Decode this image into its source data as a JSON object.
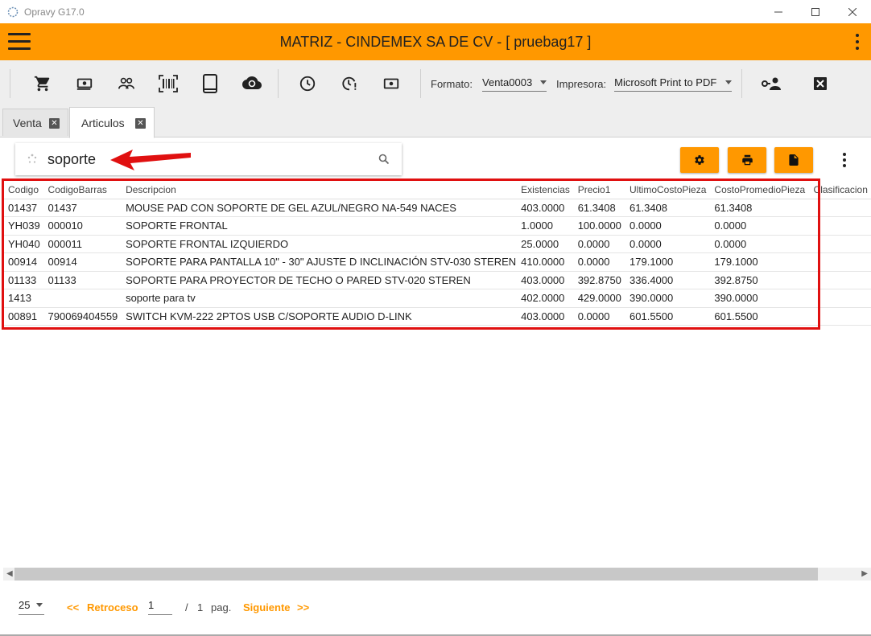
{
  "window": {
    "title": "Opravy G17.0"
  },
  "header": {
    "title": "MATRIZ - CINDEMEX SA DE CV - [ pruebag17 ]"
  },
  "toolbar": {
    "icons": [
      "cart-icon",
      "cash-icon",
      "users-icon",
      "barcode-icon",
      "tablet-icon",
      "cloud-sync-icon",
      "clock-icon",
      "clock-alert-icon",
      "money-icon"
    ],
    "formato_label": "Formato:",
    "formato_value": "Venta0003",
    "impresora_label": "Impresora:",
    "impresora_value": "Microsoft Print to PDF"
  },
  "tabs": [
    {
      "label": "Venta",
      "active": false
    },
    {
      "label": "Articulos",
      "active": true
    }
  ],
  "search": {
    "value": "soporte"
  },
  "table": {
    "columns": [
      "Codigo",
      "CodigoBarras",
      "Descripcion",
      "Existencias",
      "Precio1",
      "UltimoCostoPieza",
      "CostoPromedioPieza",
      "Clasificacion"
    ],
    "rows": [
      [
        "01437",
        "01437",
        "MOUSE PAD CON SOPORTE DE GEL  AZUL/NEGRO NA-549 NACES",
        "403.0000",
        "61.3408",
        "61.3408",
        "61.3408",
        ""
      ],
      [
        "YH039",
        "000010",
        "SOPORTE FRONTAL",
        "1.0000",
        "100.0000",
        "0.0000",
        "0.0000",
        ""
      ],
      [
        "YH040",
        "000011",
        "SOPORTE FRONTAL IZQUIERDO",
        "25.0000",
        "0.0000",
        "0.0000",
        "0.0000",
        ""
      ],
      [
        "00914",
        "00914",
        "SOPORTE PARA PANTALLA  10\" - 30\"  AJUSTE D INCLINACIÓN  STV-030 STEREN",
        "410.0000",
        "0.0000",
        "179.1000",
        "179.1000",
        ""
      ],
      [
        "01133",
        "01133",
        "SOPORTE PARA PROYECTOR DE TECHO O PARED STV-020 STEREN",
        "403.0000",
        "392.8750",
        "336.4000",
        "392.8750",
        ""
      ],
      [
        "1413",
        "",
        "soporte para tv",
        "402.0000",
        "429.0000",
        "390.0000",
        "390.0000",
        ""
      ],
      [
        "00891",
        "790069404559",
        "SWITCH KVM-222  2PTOS  USB C/SOPORTE AUDIO D-LINK",
        "403.0000",
        "0.0000",
        "601.5500",
        "601.5500",
        ""
      ]
    ]
  },
  "pager": {
    "page_size": "25",
    "prev_arrows": "<<",
    "prev_label": "Retroceso",
    "page_value": "1",
    "of_text": "/",
    "total_pages": "1",
    "pag_label": "pag.",
    "next_label": "Siguiente",
    "next_arrows": ">>"
  },
  "colors": {
    "accent": "#ff9800",
    "highlight": "#e01010"
  }
}
